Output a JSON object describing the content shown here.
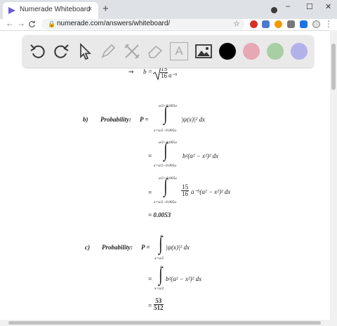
{
  "browser": {
    "tab_title": "Numerade Whiteboard",
    "tab_close": "×",
    "new_tab": "+",
    "url": "numerade.com/answers/whiteboard/",
    "window_controls": {
      "minimize": "–",
      "maximize": "☐",
      "close": "✕"
    },
    "nav": {
      "back": "←",
      "forward": "→",
      "reload": "C"
    }
  },
  "toolbar": {
    "tools": [
      "undo-icon",
      "redo-icon",
      "pointer-icon",
      "pen-icon",
      "tools-icon",
      "eraser-icon",
      "text-icon",
      "image-icon"
    ],
    "text_tool_glyph": "A",
    "colors": [
      "#000000",
      "#e8a7b4",
      "#a8cfa3",
      "#b3b1ea"
    ]
  },
  "math": {
    "top": {
      "arrow": "⇒",
      "lhs": "b =",
      "frac_num": "15",
      "frac_den": "16",
      "tail": "a⁻⁵"
    },
    "part_b": {
      "label": "b)",
      "prob_label": "Probability:",
      "P_eq": "P =",
      "upper": "a/2+0.005a",
      "lower": "x=a/2−0.005a",
      "line1": "|ψ(x)|² dx",
      "line2_eq": "=",
      "line2": "b²(a² − x²)² dx",
      "line3_eq": "=",
      "line3_num": "15",
      "line3_den": "16",
      "line3": "a⁻⁵(a² − x²)² dx",
      "result": "= 0.0053"
    },
    "part_c": {
      "label": "c)",
      "prob_label": "Probability:",
      "P_eq": "P =",
      "upper": "a",
      "lower": "x=a/2",
      "line1": "|ψ(x)|² dx",
      "line2_eq": "=",
      "line2": "b²(a² − x²)² dx",
      "res_eq": "=",
      "res_num": "53",
      "res_den": "512"
    }
  }
}
